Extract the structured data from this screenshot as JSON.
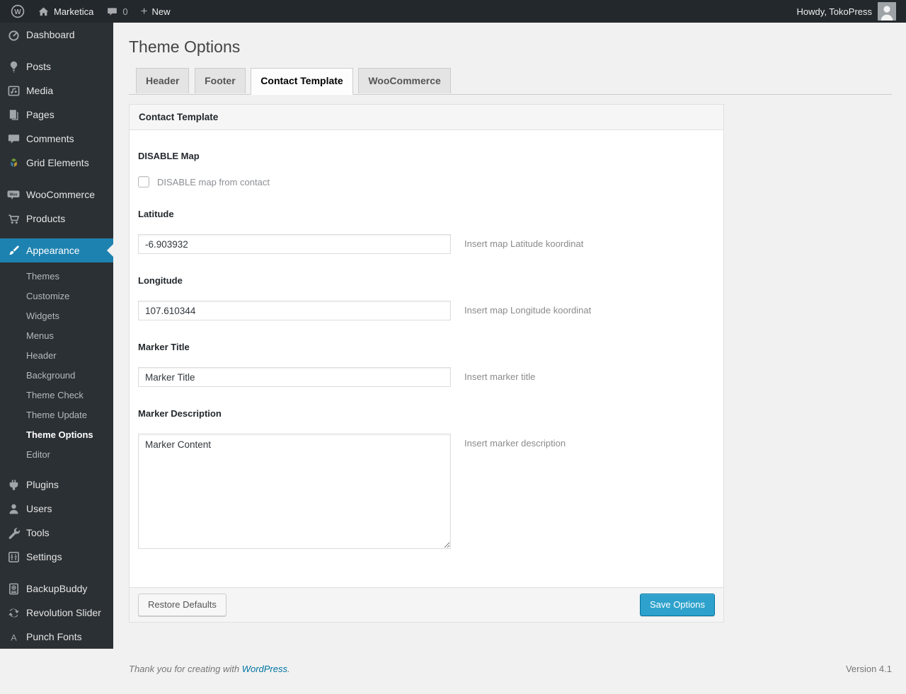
{
  "colors": {
    "admin_bar_bg": "#23282d",
    "sidebar_bg": "#2b3034",
    "menu_highlight_blue": "#1e82b0",
    "page_bg": "#f1f1f1",
    "primary_button_bg": "#2ea2cc",
    "primary_button_border": "#0074a2",
    "link_blue": "#0074a2",
    "icon_gray": "#a0a5aa"
  },
  "icons": {
    "wp_logo_letter": "W",
    "woo_badge_text": "Woo",
    "punch_fonts_letter": "A",
    "new_plus_glyph": "+"
  },
  "admin_bar": {
    "site_name": "Marketica",
    "comment_count": "0",
    "new_label": "New",
    "howdy_text": "Howdy, TokoPress"
  },
  "sidebar": {
    "items": {
      "dashboard": "Dashboard",
      "posts": "Posts",
      "media": "Media",
      "pages": "Pages",
      "comments": "Comments",
      "grid_elements": "Grid Elements",
      "woocommerce": "WooCommerce",
      "products": "Products",
      "appearance": "Appearance",
      "plugins": "Plugins",
      "users": "Users",
      "tools": "Tools",
      "settings": "Settings",
      "backupbuddy": "BackupBuddy",
      "revolution_slider": "Revolution Slider",
      "punch_fonts": "Punch Fonts"
    },
    "appearance_submenu": [
      "Themes",
      "Customize",
      "Widgets",
      "Menus",
      "Header",
      "Background",
      "Theme Check",
      "Theme Update",
      "Theme Options",
      "Editor"
    ],
    "current_item": "Appearance",
    "current_submenu_item": "Theme Options"
  },
  "page": {
    "title": "Theme Options",
    "active_tab": "Contact Template",
    "tabs": [
      {
        "label": "Header"
      },
      {
        "label": "Footer"
      },
      {
        "label": "Contact Template"
      },
      {
        "label": "WooCommerce"
      }
    ]
  },
  "panel": {
    "title": "Contact Template",
    "disable_map": {
      "label": "DISABLE Map",
      "checkbox_label": "DISABLE map from contact",
      "checked": false
    },
    "latitude": {
      "label": "Latitude",
      "value": "-6.903932",
      "hint": "Insert map Latitude koordinat"
    },
    "longitude": {
      "label": "Longitude",
      "value": "107.610344",
      "hint": "Insert map Longitude koordinat"
    },
    "marker_title": {
      "label": "Marker Title",
      "value": "Marker Title",
      "hint": "Insert marker title"
    },
    "marker_description": {
      "label": "Marker Description",
      "value": "Marker Content",
      "hint": "Insert marker description"
    },
    "restore_button": "Restore Defaults",
    "save_button": "Save Options"
  },
  "page_footer": {
    "thanks_text": "Thank you for creating with ",
    "link_text": "WordPress",
    "period": ".",
    "version": "Version 4.1"
  }
}
